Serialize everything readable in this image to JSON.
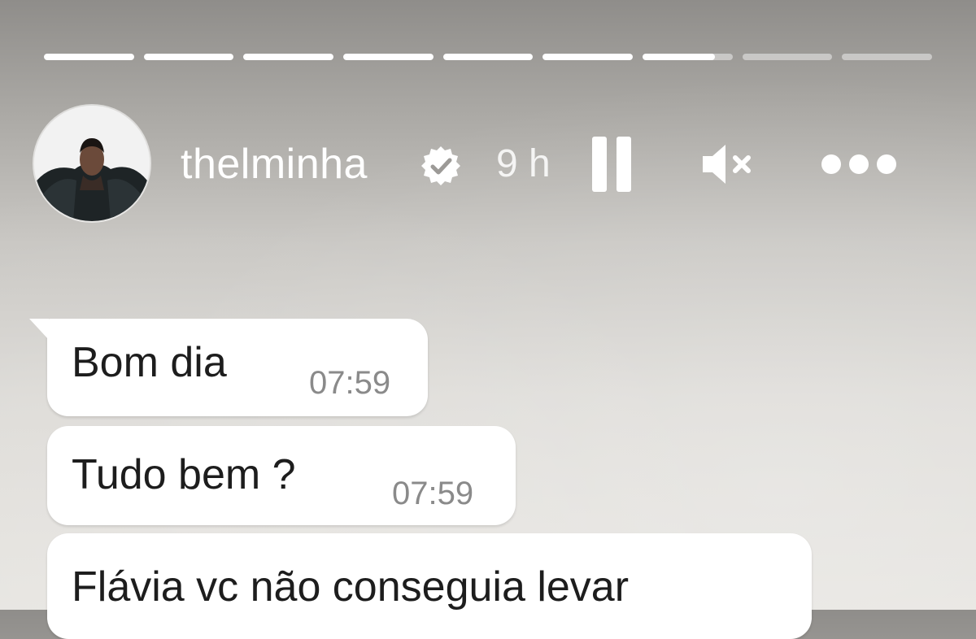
{
  "story": {
    "segments": [
      1,
      1,
      1,
      1,
      1,
      1,
      0.8,
      0,
      0
    ],
    "user": {
      "username": "thelminha",
      "verified": true,
      "time_ago": "9 h",
      "avatar_icon": "profile-photo"
    },
    "controls": {
      "pause_icon": "pause-icon",
      "mute_icon": "speaker-muted-icon",
      "more_icon": "more-options-icon"
    }
  },
  "chat": {
    "messages": [
      {
        "text": "Bom dia",
        "time": "07:59"
      },
      {
        "text": "Tudo bem ?",
        "time": "07:59"
      },
      {
        "text": "Flávia vc não conseguia levar",
        "time": ""
      }
    ]
  },
  "colors": {
    "bubble": "#ffffff",
    "text": "#1d1d1d",
    "timestamp": "#8a8a8a",
    "progress_active": "#ffffff",
    "progress_inactive": "rgba(255,255,255,0.45)"
  }
}
